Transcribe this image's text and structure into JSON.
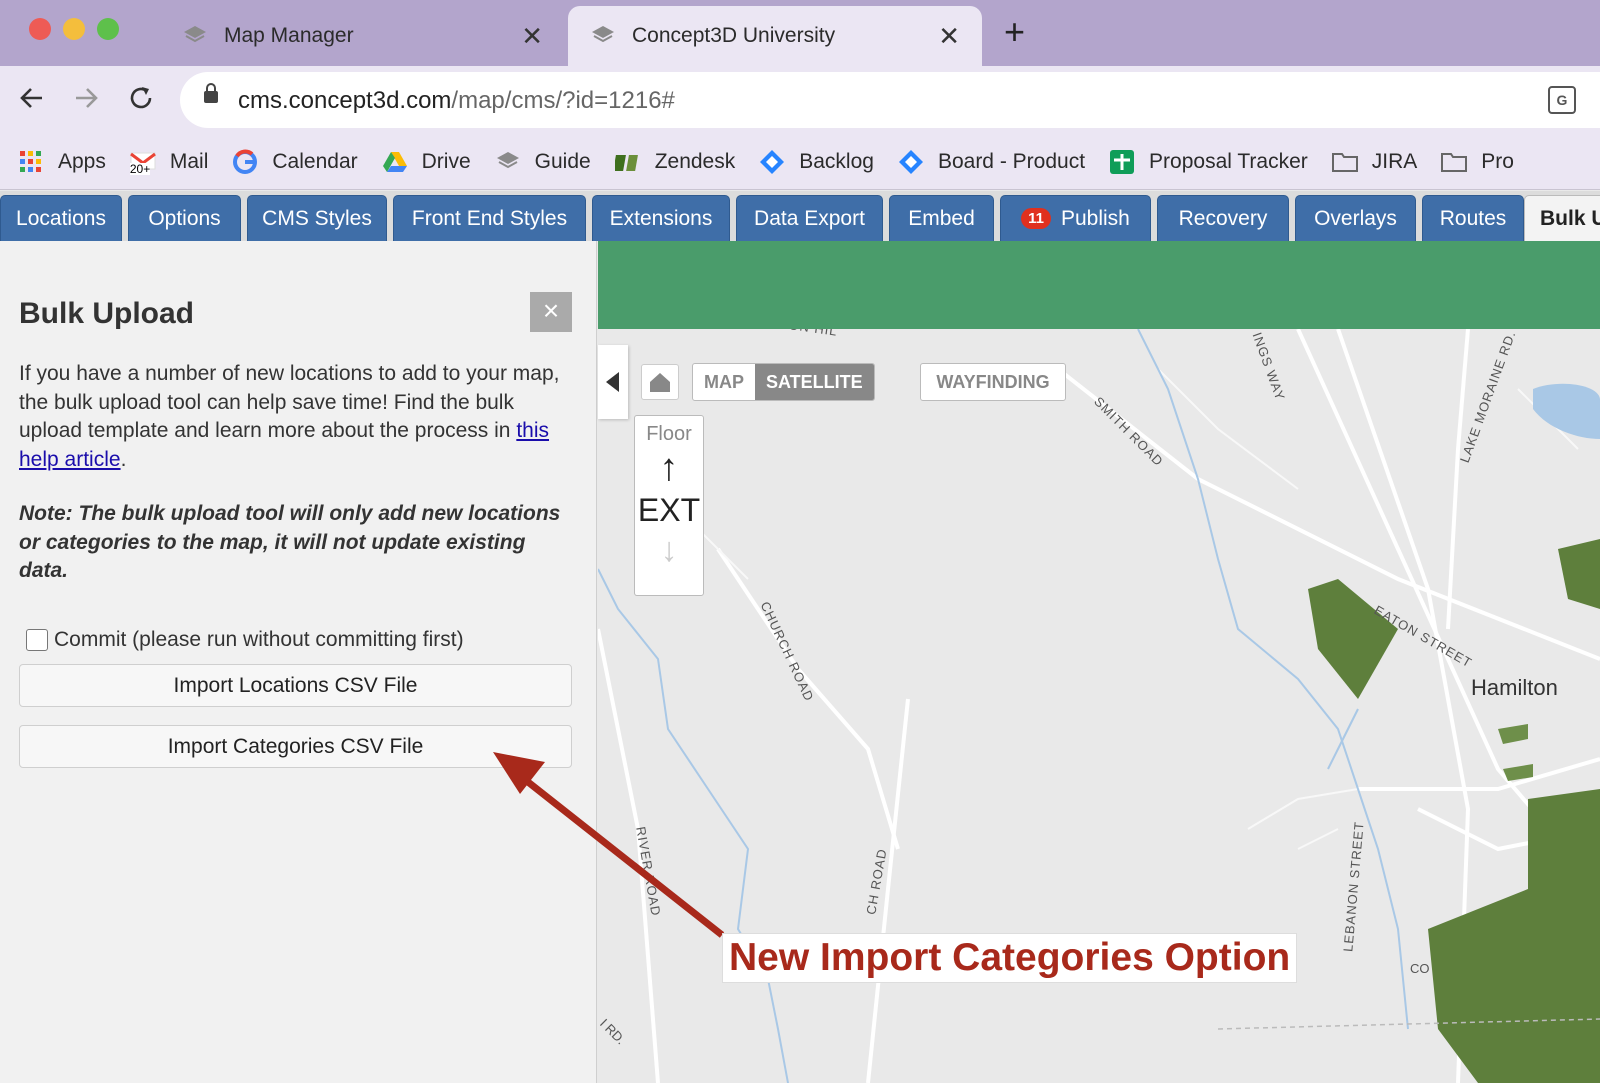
{
  "browser": {
    "tabs": [
      {
        "label": "Map Manager",
        "active": false
      },
      {
        "label": "Concept3D University",
        "active": true
      }
    ],
    "url_host": "cms.concept3d.com",
    "url_path": "/map/cms/?id=1216#",
    "bookmarks": [
      "Apps",
      "Mail",
      "Calendar",
      "Drive",
      "Guide",
      "Zendesk",
      "Backlog",
      "Board - Product",
      "Proposal Tracker",
      "JIRA",
      "Pro"
    ],
    "mail_badge": "20+"
  },
  "cms_tabs": {
    "items": [
      "Locations",
      "Options",
      "CMS Styles",
      "Front End Styles",
      "Extensions",
      "Data Export",
      "Embed",
      "Publish",
      "Recovery",
      "Overlays",
      "Routes",
      "Bulk U"
    ],
    "publish_badge": "11",
    "active": "Bulk U"
  },
  "panel": {
    "title": "Bulk Upload",
    "close_symbol": "×",
    "intro_text": "If you have a number of new locations to add to your map, the bulk upload tool can help save time! Find the bulk upload template and learn more about the process in ",
    "intro_link": "this help article",
    "intro_end": ".",
    "note": "Note: The bulk upload tool will only add new locations or categories to the map, it will not update existing data.",
    "commit_label": "Commit (please run without committing first)",
    "commit_checked": false,
    "import_locations": "Import Locations CSV File",
    "import_categories": "Import Categories CSV File"
  },
  "map": {
    "mode_map": "MAP",
    "mode_satellite": "SATELLITE",
    "wayfinding": "WAYFINDING",
    "floor_label": "Floor",
    "floor_up": "↑",
    "floor_value": "EXT",
    "floor_down": "↓",
    "labels": {
      "hilton": "ILTON HIL",
      "kings_way": "INGS WAY",
      "lake_moraine": "LAKE MORAINE RD.",
      "smith_road": "SMITH ROAD",
      "church_road": "CHURCH ROAD",
      "eaton_street": "EATON STREET",
      "hamilton": "Hamilton",
      "river_road": "RIVER ROAD",
      "church_road_2": "CH ROAD",
      "lebanon_street": "LEBANON STREET",
      "co": "CO",
      "rd": "I RD."
    }
  },
  "annotation": {
    "text": "New Import Categories Option",
    "color": "#a8291b"
  },
  "colors": {
    "tabbar": "#b3a5cc",
    "nav_tab": "#3f6ea8",
    "greenbar": "#4a9c6b",
    "badge": "#e0301e"
  }
}
